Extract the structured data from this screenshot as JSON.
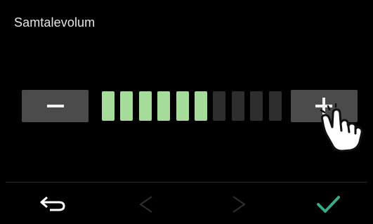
{
  "screen": {
    "title": "Samtalevolum"
  },
  "volume": {
    "level": 6,
    "max": 10,
    "active_color": "#a6dc9a",
    "inactive_color": "#2e2e2e"
  },
  "controls": {
    "decrease_icon": "minus-icon",
    "increase_icon": "plus-icon"
  },
  "footer": {
    "back_icon": "return-arrow-icon",
    "prev_icon": "chevron-left-icon",
    "next_icon": "chevron-right-icon",
    "confirm_icon": "checkmark-icon",
    "confirm_color": "#3aa88c",
    "disabled_color": "#2f2f2f"
  },
  "overlay": {
    "pointer_icon": "tapping-hand-icon"
  }
}
